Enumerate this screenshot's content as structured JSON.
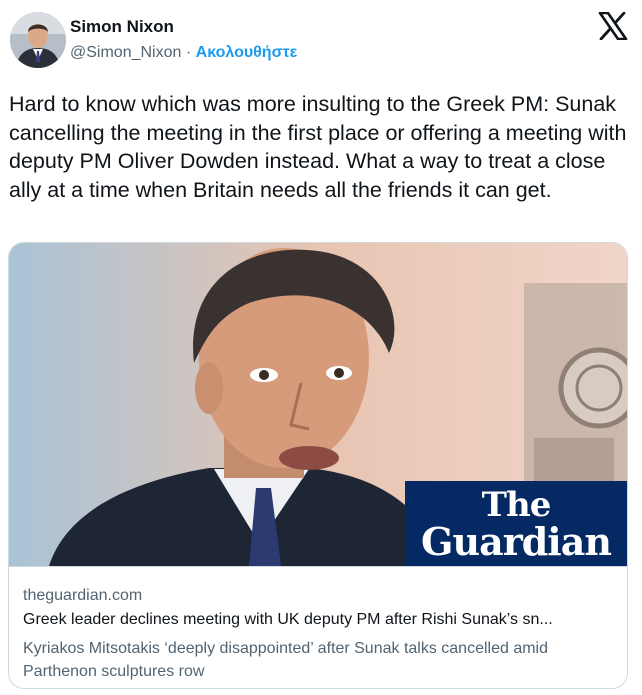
{
  "author": {
    "name": "Simon Nixon",
    "handle": "@Simon_Nixon",
    "separator": "·",
    "follow_label": "Ακολουθήστε"
  },
  "icons": {
    "platform": "x-logo-icon",
    "avatar": "avatar-photo"
  },
  "tweet": {
    "text": "Hard to know which was more insulting to the Greek PM: Sunak cancelling the meeting in the first place or offering a meeting with deputy PM Oliver Dowden instead. What a way to treat a close ally at a time when Britain needs all the friends it can get."
  },
  "card": {
    "domain": "theguardian.com",
    "title": "Greek leader declines meeting with UK deputy PM after Rishi Sunak’s sn...",
    "description": "Kyriakos Mitsotakis ‘deeply disappointed’ after Sunak talks cancelled amid Parthenon sculptures row",
    "brand_line1": "The",
    "brand_line2": "Guardian"
  },
  "colors": {
    "text": "#0f1419",
    "secondary": "#536471",
    "link": "#1d9bf0",
    "border": "#cfd9de",
    "brand_bg": "#052962"
  }
}
